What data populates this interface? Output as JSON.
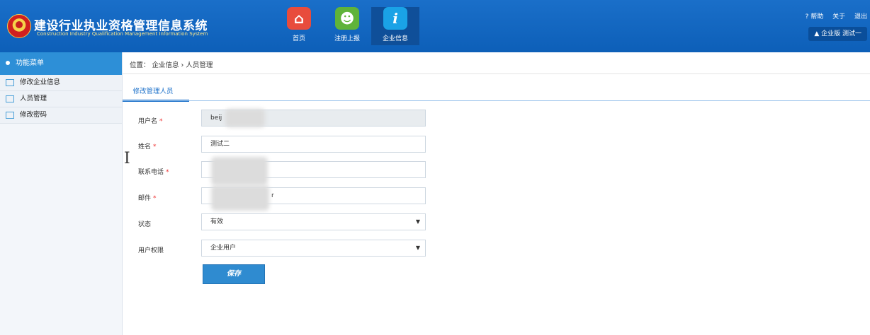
{
  "header": {
    "title": "建设行业执业资格管理信息系统",
    "subtitle": "Construction Industry Qualification Management Information System",
    "nav": [
      {
        "label": "首页",
        "icon": "home-icon"
      },
      {
        "label": "注册上报",
        "icon": "user-register-icon"
      },
      {
        "label": "企业信息",
        "icon": "info-icon"
      }
    ],
    "links": {
      "help": "? 帮助",
      "about": "关于",
      "logout": "退出"
    },
    "user": {
      "icon": "user-icon",
      "text": "企业版  测试一"
    }
  },
  "sidebar": {
    "title": "功能菜单",
    "items": [
      {
        "label": "修改企业信息"
      },
      {
        "label": "人员管理"
      },
      {
        "label": "修改密码"
      }
    ]
  },
  "breadcrumb": "位置：  企业信息  ›  人员管理",
  "tab": "修改管理人员",
  "form": {
    "username": {
      "label": "用户名",
      "value": "beij"
    },
    "name": {
      "label": "姓名",
      "value": "测试二"
    },
    "phone": {
      "label": "联系电话",
      "value": ""
    },
    "email": {
      "label": "邮件",
      "value": "r"
    },
    "status": {
      "label": "状态",
      "value": "有效"
    },
    "permission": {
      "label": "用户权限",
      "value": "企业用户"
    },
    "required_mark": "*",
    "save_label": "保存"
  },
  "colors": {
    "header_bg": "#0d5fb8",
    "accent": "#2d8fd7",
    "required": "#ee3333"
  }
}
